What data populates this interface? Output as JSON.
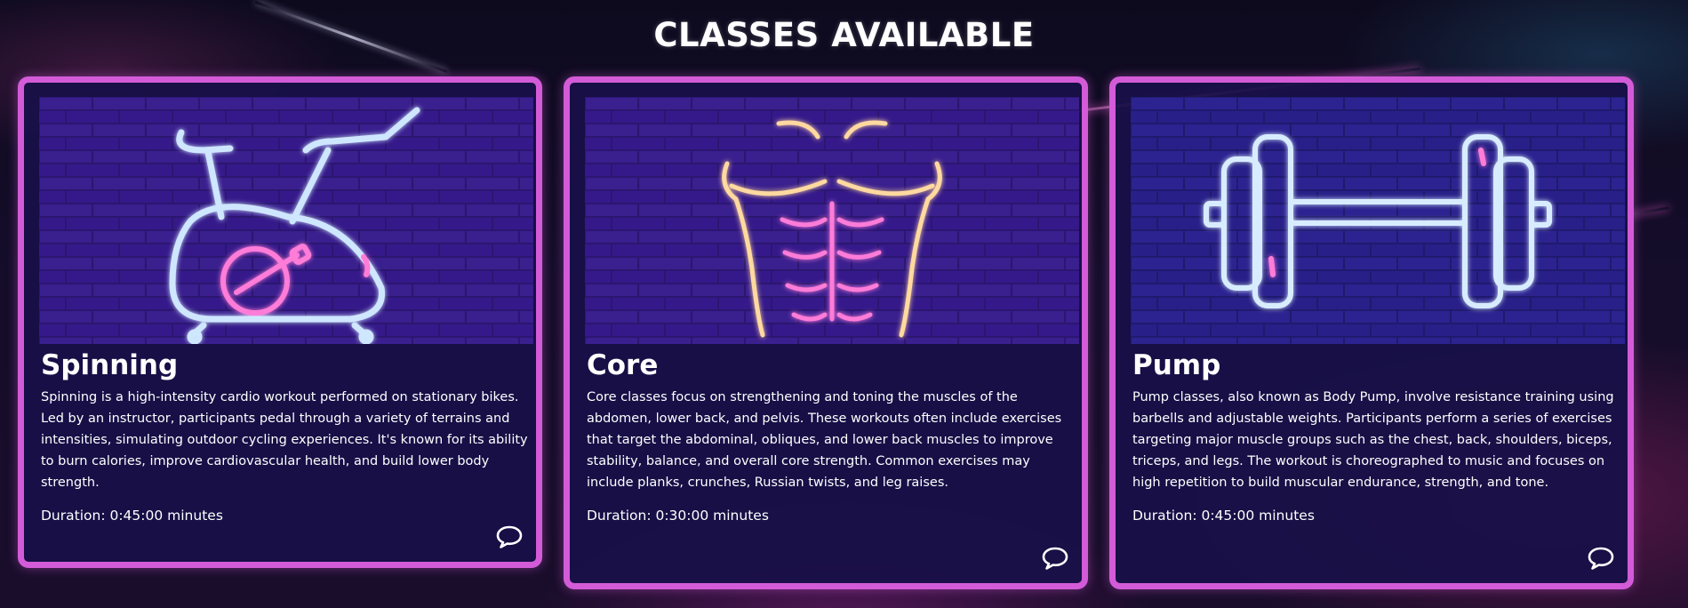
{
  "page": {
    "title": "CLASSES AVAILABLE",
    "accent_color": "#d35bd8",
    "card_bg_color": "#181048"
  },
  "classes": [
    {
      "name": "Spinning",
      "image_icon": "stationary-bike-neon-icon",
      "description": "Spinning is a high-intensity cardio workout performed on stationary bikes. Led by an instructor, participants pedal through a variety of terrains and intensities, simulating outdoor cycling experiences. It's known for its ability to burn calories, improve cardiovascular health, and build lower body strength.",
      "duration": "Duration: 0:45:00 minutes",
      "comment_icon": "comment-icon"
    },
    {
      "name": "Core",
      "image_icon": "abdominal-torso-neon-icon",
      "description": "Core classes focus on strengthening and toning the muscles of the abdomen, lower back, and pelvis. These workouts often include exercises that target the abdominal, obliques, and lower back muscles to improve stability, balance, and overall core strength. Common exercises may include planks, crunches, Russian twists, and leg raises.",
      "duration": "Duration: 0:30:00 minutes",
      "comment_icon": "comment-icon"
    },
    {
      "name": "Pump",
      "image_icon": "barbell-neon-icon",
      "description": "Pump classes, also known as Body Pump, involve resistance training using barbells and adjustable weights. Participants perform a series of exercises targeting major muscle groups such as the chest, back, shoulders, biceps, triceps, and legs. The workout is choreographed to music and focuses on high repetition to build muscular endurance, strength, and tone.",
      "duration": "Duration: 0:45:00 minutes",
      "comment_icon": "comment-icon"
    }
  ]
}
